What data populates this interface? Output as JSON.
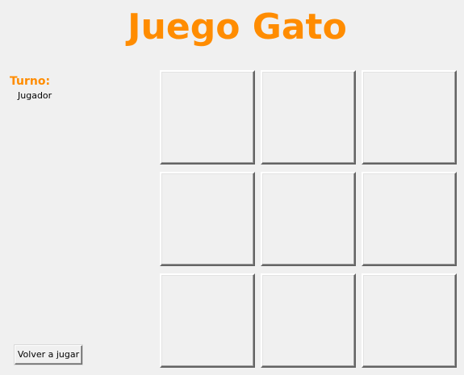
{
  "window": {
    "title": "Juego Gato"
  },
  "colors": {
    "accent": "#ff8c00",
    "background": "#f0f0f0",
    "text": "#000000"
  },
  "status": {
    "turn_label": "Turno:",
    "turn_value": "Jugador"
  },
  "board": {
    "cells": [
      "",
      "",
      "",
      "",
      "",
      "",
      "",
      "",
      ""
    ]
  },
  "actions": {
    "replay_label": "Volver a jugar"
  }
}
